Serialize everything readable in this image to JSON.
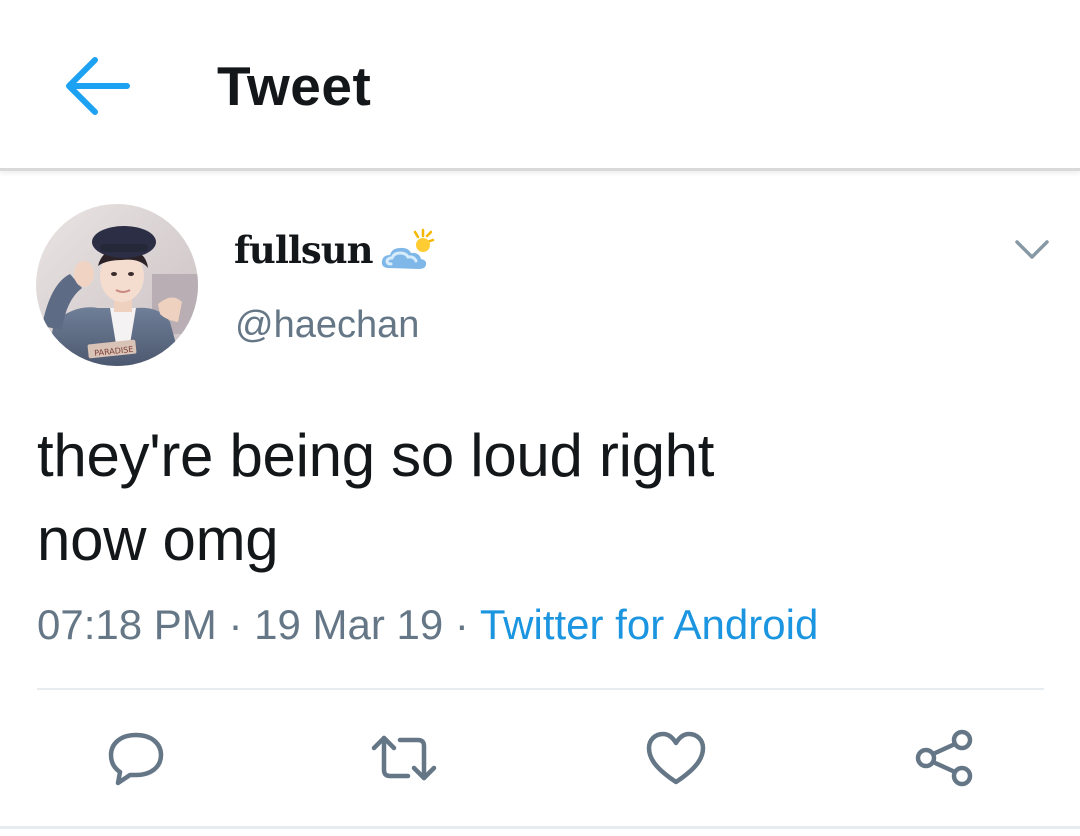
{
  "header": {
    "title": "Tweet",
    "back_icon": "arrow-left-icon",
    "accent_color": "#1da1f2"
  },
  "tweet": {
    "display_name": "fullsun",
    "name_emoji_icon": "sun-behind-cloud-icon",
    "handle": "@haechan",
    "avatar_caption": "PARADISE",
    "text_line_1": "they're being so loud right",
    "text_line_2": "now omg",
    "time": "07:18 PM",
    "separator": "·",
    "date": "19 Mar 19",
    "source": "Twitter for Android",
    "source_color": "#1b95e0",
    "menu_icon": "chevron-down-icon"
  },
  "actions": [
    {
      "name": "reply",
      "icon": "reply-icon"
    },
    {
      "name": "retweet",
      "icon": "retweet-icon"
    },
    {
      "name": "like",
      "icon": "heart-icon"
    },
    {
      "name": "share",
      "icon": "share-icon"
    }
  ]
}
